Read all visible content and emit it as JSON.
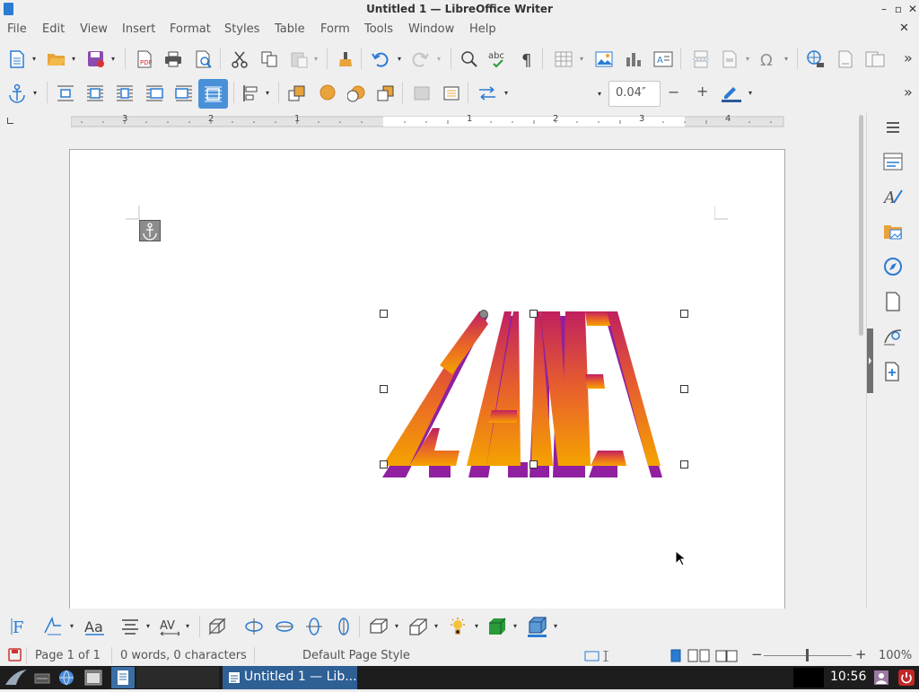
{
  "window": {
    "title": "Untitled 1 — LibreOffice Writer",
    "minimize": "–",
    "maximize": "▫",
    "close": "✕",
    "doc_close": "✕"
  },
  "menu": [
    "File",
    "Edit",
    "View",
    "Insert",
    "Format",
    "Styles",
    "Table",
    "Form",
    "Tools",
    "Window",
    "Help"
  ],
  "frame_toolbar": {
    "line_width_value": "0.04″",
    "minus": "−",
    "plus": "+"
  },
  "ruler": {
    "labels": [
      "3",
      "2",
      "1",
      "1",
      "2",
      "3",
      "4"
    ]
  },
  "fontwork": {
    "text": "PLANET",
    "colors": {
      "top": "#f5a300",
      "mid": "#e8602c",
      "bottom": "#c02060",
      "extrude": "#9020a0"
    }
  },
  "statusbar": {
    "page": "Page 1 of 1",
    "words": "0 words, 0 characters",
    "page_style": "Default Page Style",
    "zoom": "100%",
    "zoom_minus": "−",
    "zoom_plus": "+"
  },
  "taskbar": {
    "window_button": "Untitled 1 — Lib...",
    "clock": "10:56"
  },
  "colors": {
    "accent": "#3d85c6",
    "selected_bg": "#4a90d9"
  }
}
